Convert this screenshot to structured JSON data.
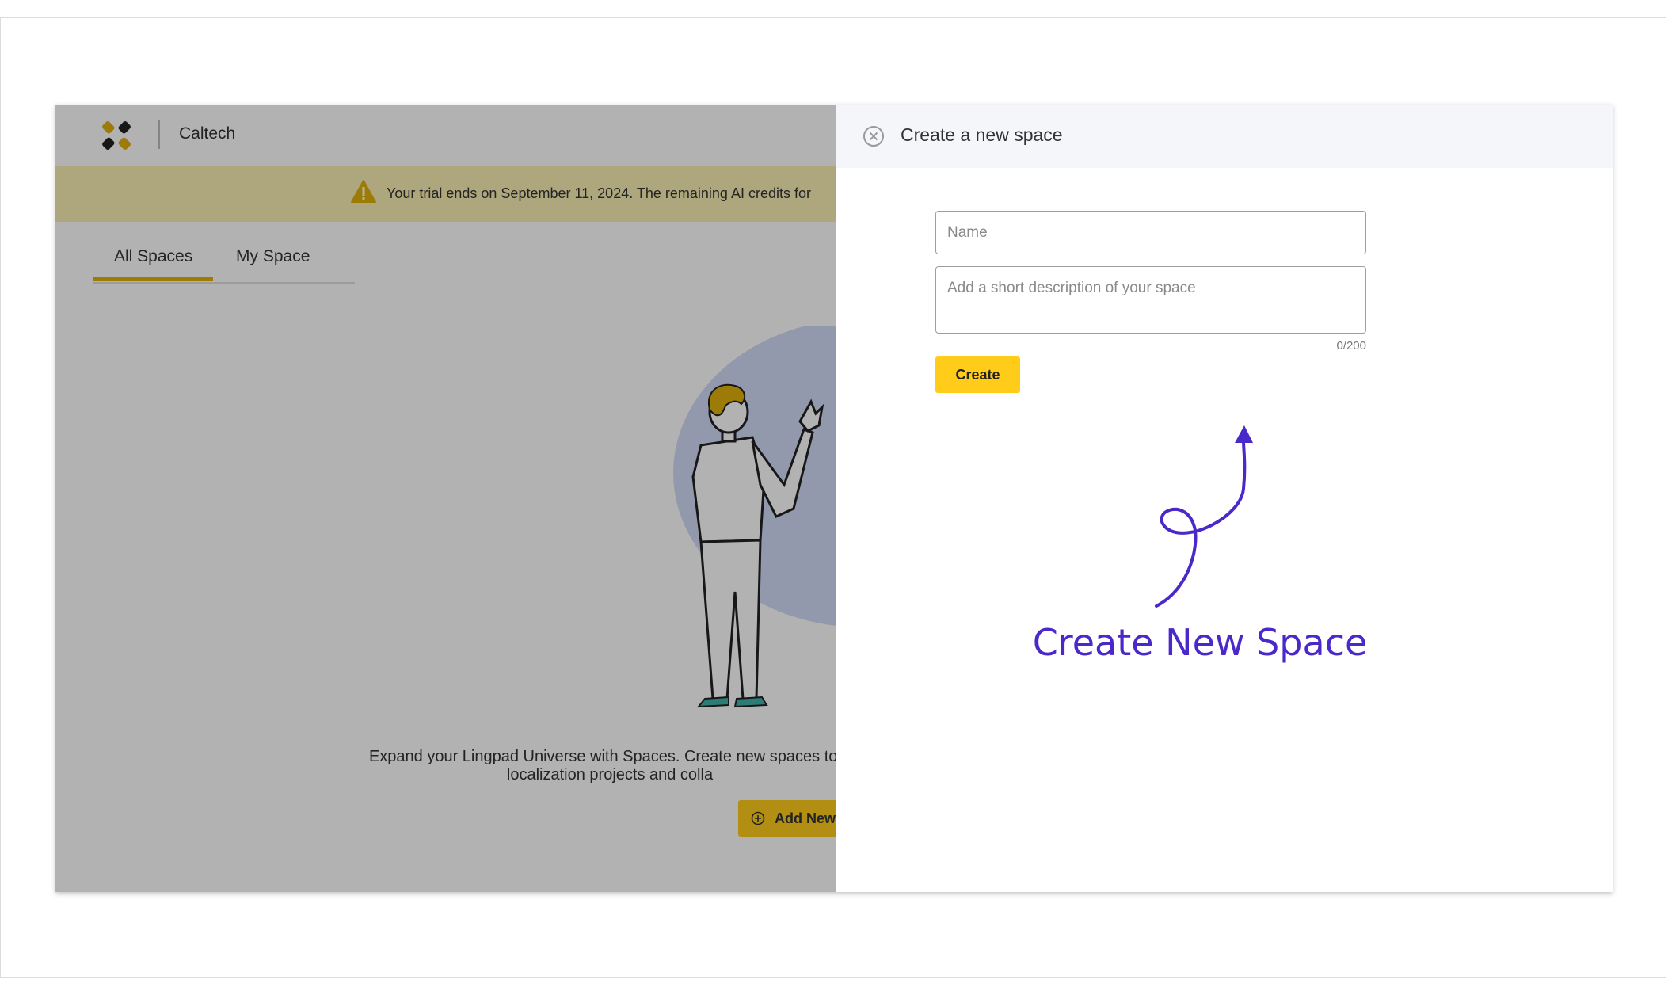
{
  "header": {
    "org_name": "Caltech"
  },
  "banner": {
    "text": "Your trial ends on September 11, 2024. The remaining AI credits for"
  },
  "tabs": [
    {
      "label": "All Spaces"
    },
    {
      "label": "My Space"
    }
  ],
  "empty_state": {
    "line1": "Expand your Lingpad Universe with Spaces. Create new spaces to o",
    "line2": "localization projects and colla",
    "add_button_label": "Add New"
  },
  "drawer": {
    "title": "Create a new space",
    "name_placeholder": "Name",
    "description_placeholder": "Add a short description of your space",
    "counter": "0/200",
    "create_label": "Create"
  },
  "annotation": {
    "text": "Create New Space"
  },
  "colors": {
    "accent": "#ffcc1a",
    "annotation": "#4a28c9",
    "tab_underline": "#e0b20a",
    "banner": "#f9efb4"
  },
  "icons": [
    "logo-icon",
    "warning-icon",
    "close-icon",
    "plus-circle-icon",
    "annotation-arrow-icon"
  ]
}
